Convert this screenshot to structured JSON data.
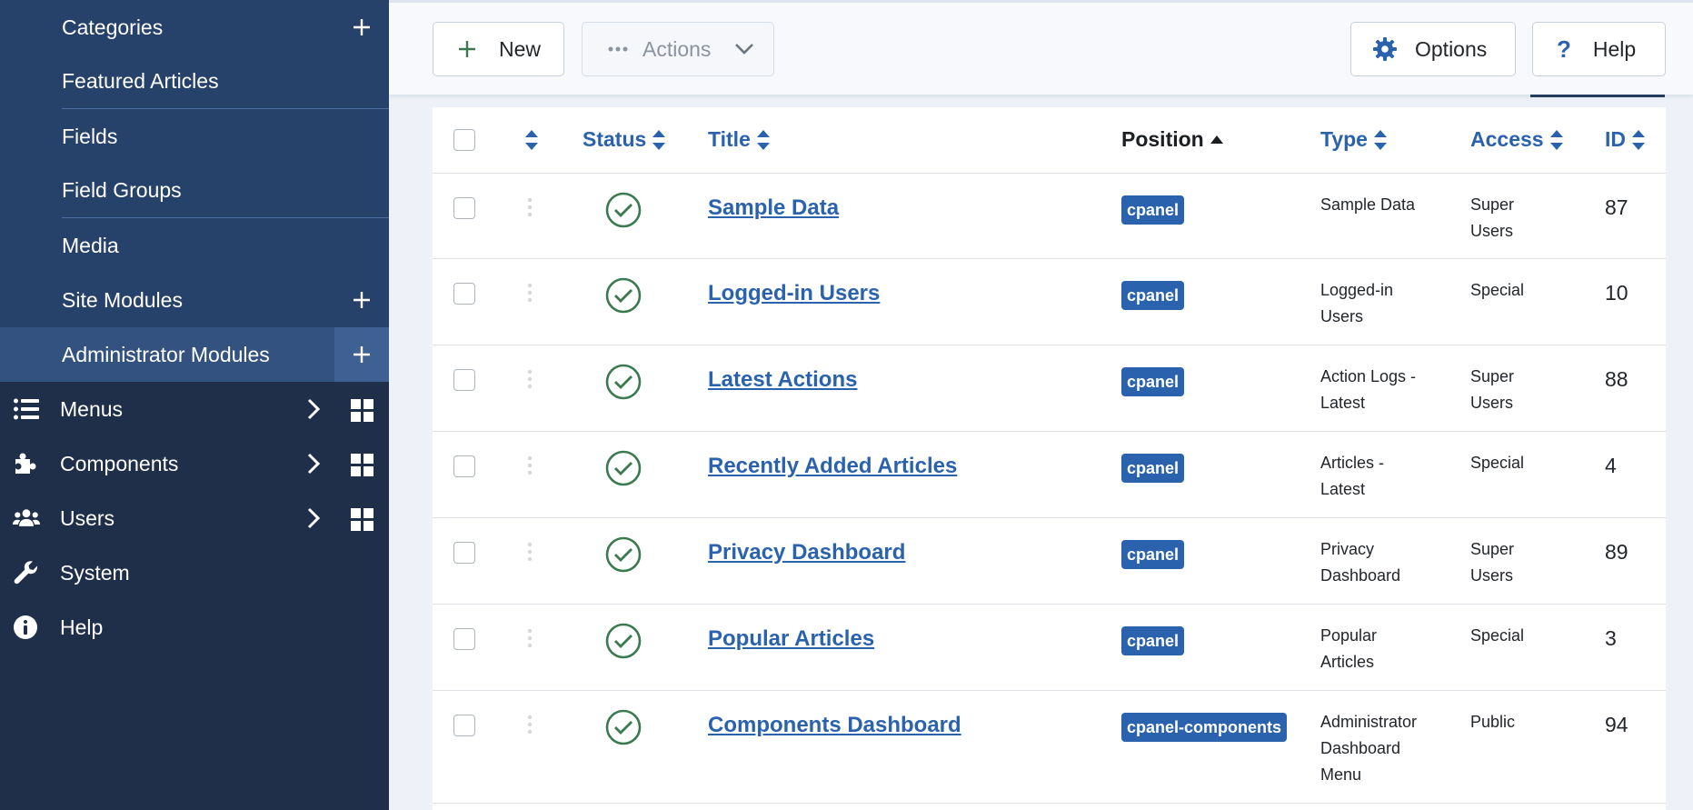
{
  "sidebar": {
    "sub_items": [
      {
        "label": "Categories",
        "has_add": true
      },
      {
        "label": "Featured Articles",
        "has_add": false
      },
      {
        "label": "Fields",
        "has_add": false
      },
      {
        "label": "Field Groups",
        "has_add": false
      },
      {
        "label": "Media",
        "has_add": false
      },
      {
        "label": "Site Modules",
        "has_add": true
      },
      {
        "label": "Administrator Modules",
        "has_add": true,
        "active": true
      }
    ],
    "main_items": [
      {
        "label": "Menus",
        "icon": "list-icon"
      },
      {
        "label": "Components",
        "icon": "puzzle-icon"
      },
      {
        "label": "Users",
        "icon": "users-icon"
      },
      {
        "label": "System",
        "icon": "wrench-icon"
      },
      {
        "label": "Help",
        "icon": "info-icon"
      }
    ]
  },
  "toolbar": {
    "new_label": "New",
    "actions_label": "Actions",
    "options_label": "Options",
    "help_label": "Help"
  },
  "table": {
    "headers": {
      "status": "Status",
      "title": "Title",
      "position": "Position",
      "type": "Type",
      "access": "Access",
      "id": "ID"
    },
    "rows": [
      {
        "title": "Sample Data",
        "position": "cpanel",
        "type_lines": [
          "Sample Data"
        ],
        "access_lines": [
          "Super",
          "Users"
        ],
        "id": "87"
      },
      {
        "title": "Logged-in Users",
        "position": "cpanel",
        "type_lines": [
          "Logged-in",
          "Users"
        ],
        "access_lines": [
          "Special"
        ],
        "id": "10"
      },
      {
        "title": "Latest Actions",
        "position": "cpanel",
        "type_lines": [
          "Action Logs -",
          "Latest"
        ],
        "access_lines": [
          "Super",
          "Users"
        ],
        "id": "88"
      },
      {
        "title": "Recently Added Articles",
        "position": "cpanel",
        "type_lines": [
          "Articles -",
          "Latest"
        ],
        "access_lines": [
          "Special"
        ],
        "id": "4"
      },
      {
        "title": "Privacy Dashboard",
        "position": "cpanel",
        "type_lines": [
          "Privacy",
          "Dashboard"
        ],
        "access_lines": [
          "Super",
          "Users"
        ],
        "id": "89"
      },
      {
        "title": "Popular Articles",
        "position": "cpanel",
        "type_lines": [
          "Popular",
          "Articles"
        ],
        "access_lines": [
          "Special"
        ],
        "id": "3"
      },
      {
        "title": "Components Dashboard",
        "position": "cpanel-components",
        "type_lines": [
          "Administrator",
          "Dashboard",
          "Menu"
        ],
        "access_lines": [
          "Public"
        ],
        "id": "94"
      }
    ]
  },
  "colors": {
    "sidebar_bg": "#1f2f49",
    "submenu_bg": "#27426a",
    "accent": "#2a62ad",
    "published": "#3a7a4e"
  }
}
